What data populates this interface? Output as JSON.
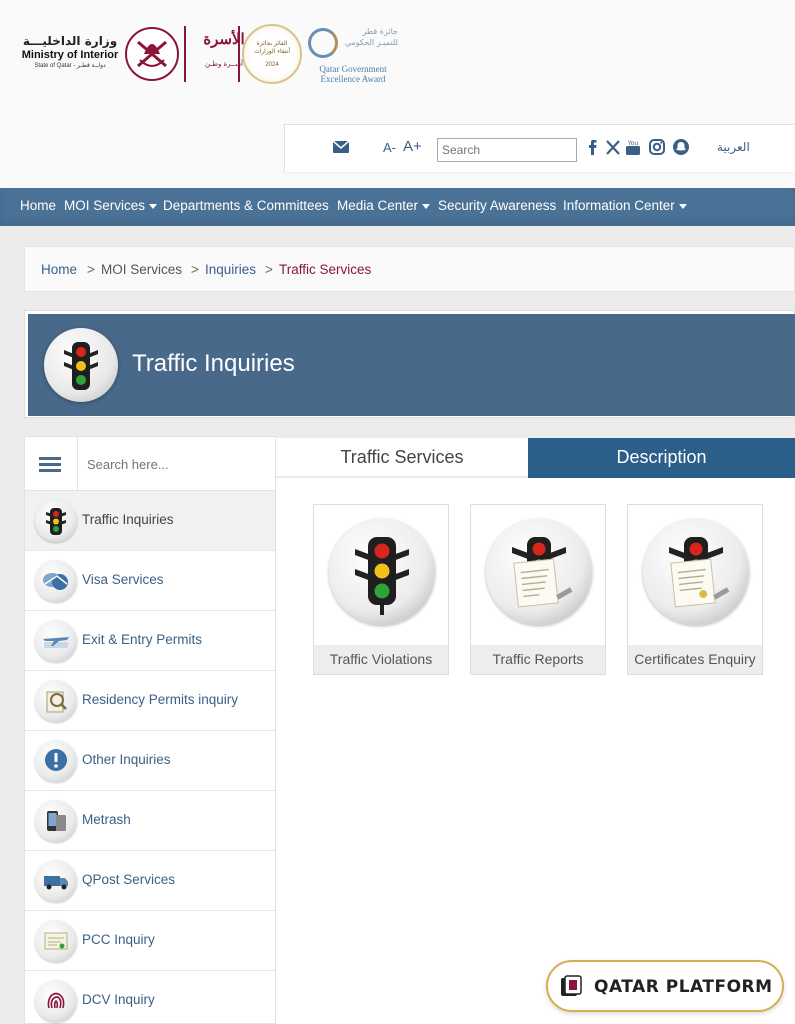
{
  "header": {
    "moi_arabic": "وزارة الداخليـــة",
    "moi_english": "Ministry of Interior",
    "moi_sub": "State of Qatar - دولــة قطـر",
    "usra_arabic": "الأسرة",
    "usra_sub": "أســرة وطـن",
    "award_circle_text": "الفائز بجائزة أنتقاء الوزارات",
    "award_circle_year": "2024",
    "qgea_arabic": "جائزة قطر للتميـز الحكومي",
    "qgea_english": "Qatar Government Excellence Award"
  },
  "toolbar": {
    "font_decrease": "A-",
    "font_increase": "A+",
    "search_placeholder": "Search",
    "arabic_link": "العربية"
  },
  "nav": {
    "items": [
      {
        "label": "Home",
        "dropdown": false
      },
      {
        "label": "MOI Services",
        "dropdown": true
      },
      {
        "label": "Departments & Committees",
        "dropdown": false
      },
      {
        "label": "Media Center",
        "dropdown": true
      },
      {
        "label": "Security Awareness",
        "dropdown": false
      },
      {
        "label": "Information Center",
        "dropdown": true
      }
    ]
  },
  "breadcrumb": {
    "home": "Home",
    "sep": ">",
    "moi_services": "MOI Services",
    "inquiries": "Inquiries",
    "current": "Traffic Services"
  },
  "banner": {
    "title": "Traffic Inquiries"
  },
  "sidebar": {
    "search_placeholder": "Search here...",
    "items": [
      {
        "label": "Traffic Inquiries",
        "icon": "traffic-light-icon"
      },
      {
        "label": "Visa Services",
        "icon": "visa-icon"
      },
      {
        "label": "Exit & Entry Permits",
        "icon": "airplane-icon"
      },
      {
        "label": "Residency Permits inquiry",
        "icon": "residency-icon"
      },
      {
        "label": "Other Inquiries",
        "icon": "info-icon"
      },
      {
        "label": "Metrash",
        "icon": "phone-icon"
      },
      {
        "label": "QPost Services",
        "icon": "delivery-van-icon"
      },
      {
        "label": "PCC Inquiry",
        "icon": "certificate-icon"
      },
      {
        "label": "DCV Inquiry",
        "icon": "fingerprint-icon"
      }
    ]
  },
  "tabs": {
    "services": "Traffic Services",
    "description": "Description"
  },
  "cards": [
    {
      "label": "Traffic Violations"
    },
    {
      "label": "Traffic Reports"
    },
    {
      "label": "Certificates Enquiry"
    }
  ],
  "watermark": {
    "text": "QATAR PLATFORM"
  },
  "colors": {
    "nav_bg": "#4a7196",
    "banner_bg": "#48698a",
    "tab_active": "#2b5f8a",
    "link": "#3a5f86",
    "accent_maroon": "#8a1538"
  }
}
